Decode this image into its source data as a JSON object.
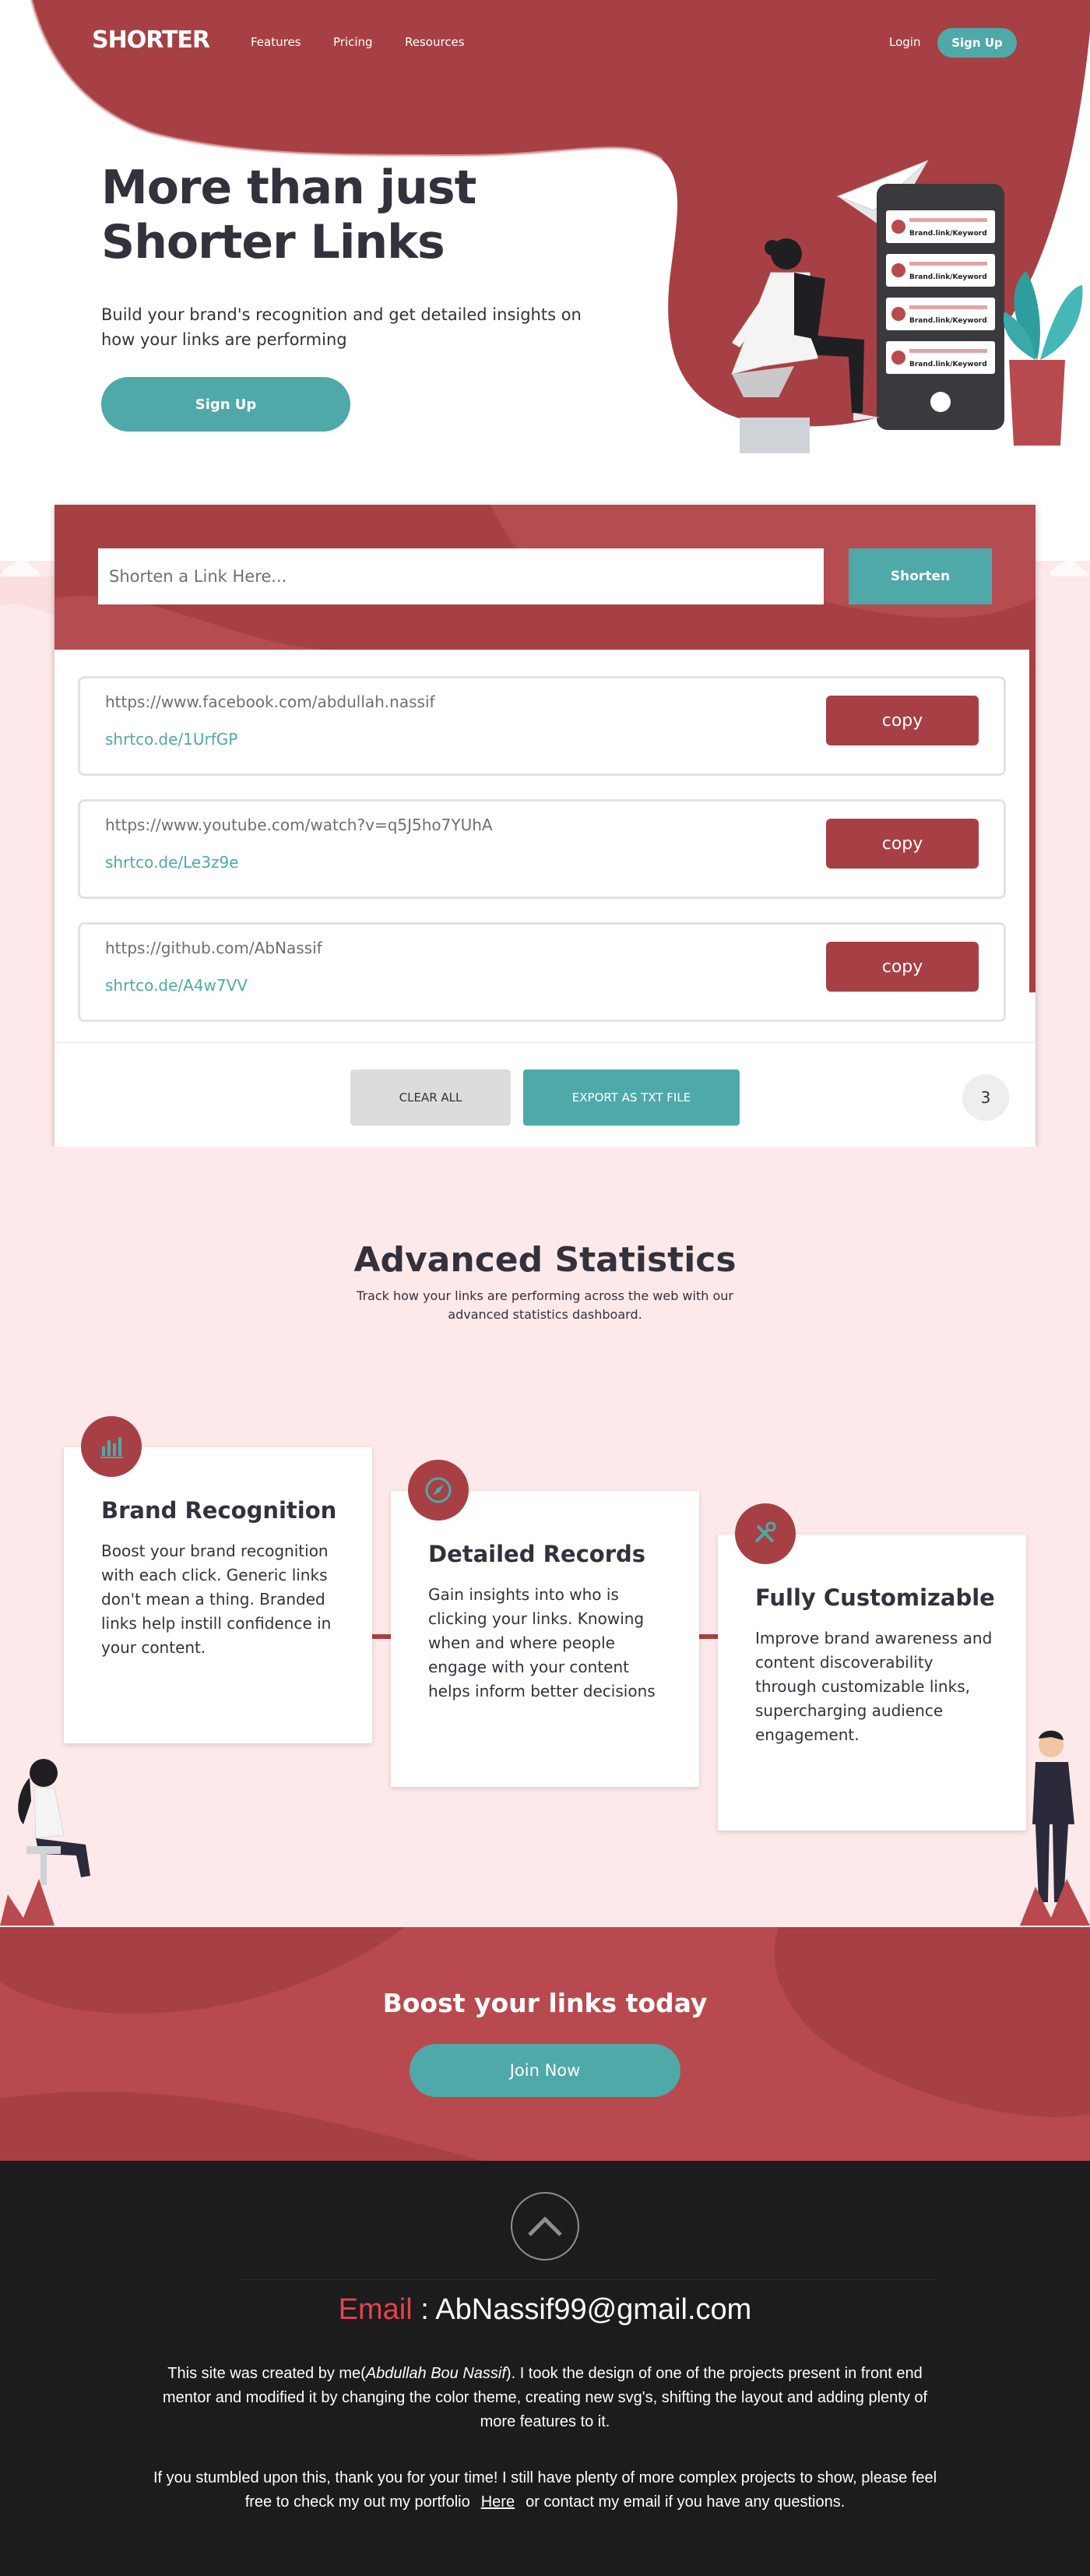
{
  "nav": {
    "logo": "SHORTER",
    "links": [
      "Features",
      "Pricing",
      "Resources"
    ],
    "login": "Login",
    "signup": "Sign Up"
  },
  "hero": {
    "title_line1": "More than just",
    "title_line2": "Shorter Links",
    "subtitle": "Build your brand's recognition and get detailed insights on how your links are performing",
    "cta": "Sign Up",
    "phone_label": "Brand.link/Keyword"
  },
  "shortener": {
    "placeholder": "Shorten a Link Here...",
    "button": "Shorten",
    "results": [
      {
        "long": "https://www.facebook.com/abdullah.nassif",
        "short": "shrtco.de/1UrfGP",
        "copy": "copy"
      },
      {
        "long": "https://www.youtube.com/watch?v=q5J5ho7YUhA",
        "short": "shrtco.de/Le3z9e",
        "copy": "copy"
      },
      {
        "long": "https://github.com/AbNassif",
        "short": "shrtco.de/A4w7VV",
        "copy": "copy"
      }
    ],
    "clear_all": "CLEAR ALL",
    "export": "EXPORT AS TXT FILE",
    "count": "3"
  },
  "stats": {
    "title": "Advanced Statistics",
    "subtitle": "Track how your links are performing across the web with our advanced statistics dashboard.",
    "cards": [
      {
        "icon": "bar-chart-icon",
        "title": "Brand Recognition",
        "text": "Boost your brand recognition with each click. Generic links don't mean a thing. Branded links help instill confidence in your content."
      },
      {
        "icon": "compass-icon",
        "title": "Detailed Records",
        "text": "Gain insights into who is clicking your links. Knowing when and where people engage with your content helps inform better decisions"
      },
      {
        "icon": "tools-icon",
        "title": "Fully Customizable",
        "text": "Improve brand awareness and content discoverability through customizable links, supercharging audience engagement."
      }
    ]
  },
  "boost": {
    "title": "Boost your links today",
    "button": "Join Now"
  },
  "footer": {
    "email_label": "Email",
    "email_sep": " : ",
    "email": "AbNassif99@gmail.com",
    "p1_a": "This site was created by me(",
    "p1_name": "Abdullah Bou Nassif",
    "p1_b": "). I took the design of one of the projects present in front end mentor and modified it by changing the color theme, creating new svg's, shifting the layout and adding plenty of more features to it.",
    "p2_a": "If you stumbled upon this, thank you for your time! I still have plenty of more complex projects to show, please feel free to check my out my portfolio",
    "p2_link": "Here",
    "p2_b": "or contact my email if you have any questions."
  },
  "colors": {
    "brand_red": "#a74044",
    "teal": "#4fa9a8",
    "pink_bg": "#fde9ea",
    "dark": "#34313d",
    "footer_bg": "#1c1b1d"
  }
}
